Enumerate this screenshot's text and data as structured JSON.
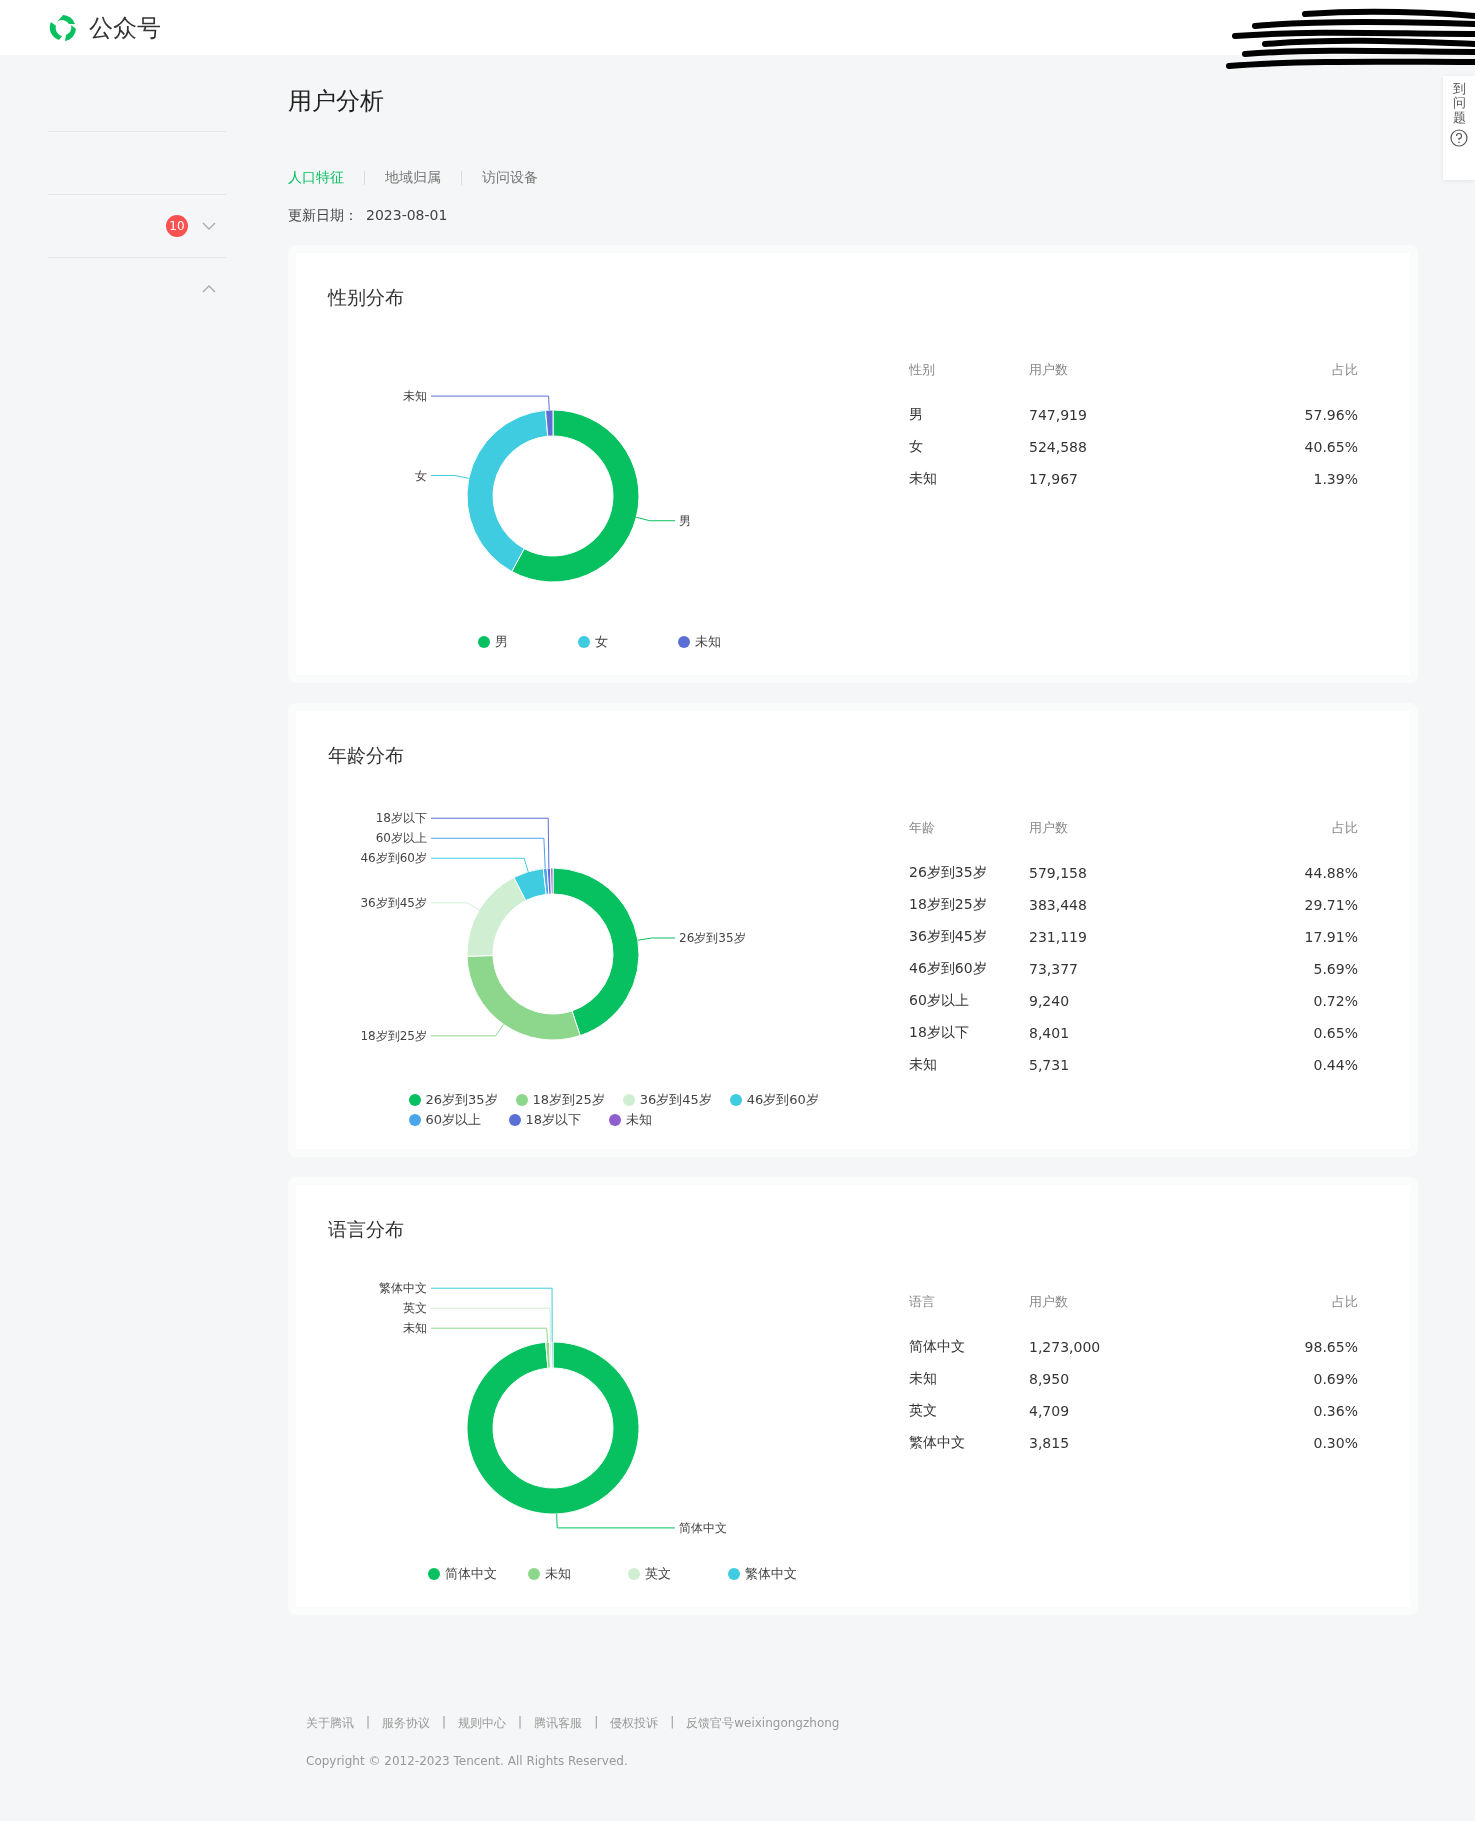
{
  "header": {
    "logo_text": "公众号"
  },
  "sidebar": {
    "badge": "10"
  },
  "help_tab": {
    "label": "到问题"
  },
  "page_title": "用户分析",
  "tabs": [
    {
      "label": "人口特征",
      "selected": true
    },
    {
      "label": "地域归属",
      "selected": false
    },
    {
      "label": "访问设备",
      "selected": false
    }
  ],
  "update_date": {
    "label": "更新日期：",
    "value": "2023-08-01"
  },
  "sections": [
    {
      "title": "性别分布",
      "columns": [
        "性别",
        "用户数",
        "占比"
      ],
      "rows": [
        [
          "男",
          "747,919",
          "57.96%"
        ],
        [
          "女",
          "524,588",
          "40.65%"
        ],
        [
          "未知",
          "17,967",
          "1.39%"
        ]
      ],
      "slice_labels": [
        "未知",
        "女",
        "男"
      ],
      "legend": [
        {
          "color": "#07c160"
        },
        {
          "color": "#40cce0"
        },
        {
          "color": "#5c6fd4"
        }
      ],
      "chart_data": {
        "type": "donut",
        "categories": [
          "男",
          "女",
          "未知"
        ],
        "values": [
          57.96,
          40.65,
          1.39
        ]
      }
    },
    {
      "title": "年龄分布",
      "columns": [
        "年龄",
        "用户数",
        "占比"
      ],
      "rows": [
        [
          "26岁到35岁",
          "579,158",
          "44.88%"
        ],
        [
          "18岁到25岁",
          "383,448",
          "29.71%"
        ],
        [
          "36岁到45岁",
          "231,119",
          "17.91%"
        ],
        [
          "46岁到60岁",
          "73,377",
          "5.69%"
        ],
        [
          "60岁以上",
          "9,240",
          "0.72%"
        ],
        [
          "18岁以下",
          "8,401",
          "0.65%"
        ],
        [
          "未知",
          "5,731",
          "0.44%"
        ]
      ],
      "slice_labels": [
        "18岁以下",
        "60岁以上",
        "46岁到60岁",
        "36岁到45岁",
        "26岁到35岁",
        "18岁到25岁"
      ],
      "legend": [
        {
          "color": "#07c160"
        },
        {
          "color": "#8dd78c"
        },
        {
          "color": "#d0efd2"
        },
        {
          "color": "#40cce0"
        },
        {
          "color": "#4aa5ec"
        },
        {
          "color": "#5c6fd4"
        },
        {
          "color": "#8f5fd0"
        }
      ],
      "chart_data": {
        "type": "donut",
        "categories": [
          "26岁到35岁",
          "18岁到25岁",
          "36岁到45岁",
          "46岁到60岁",
          "60岁以上",
          "18岁以下",
          "未知"
        ],
        "values": [
          44.88,
          29.71,
          17.91,
          5.69,
          0.72,
          0.65,
          0.44
        ]
      }
    },
    {
      "title": "语言分布",
      "columns": [
        "语言",
        "用户数",
        "占比"
      ],
      "rows": [
        [
          "简体中文",
          "1,273,000",
          "98.65%"
        ],
        [
          "未知",
          "8,950",
          "0.69%"
        ],
        [
          "英文",
          "4,709",
          "0.36%"
        ],
        [
          "繁体中文",
          "3,815",
          "0.30%"
        ]
      ],
      "slice_labels": [
        "繁体中文",
        "英文",
        "未知",
        "简体中文"
      ],
      "legend": [
        {
          "color": "#07c160"
        },
        {
          "color": "#8dd78c"
        },
        {
          "color": "#d0efd2"
        },
        {
          "color": "#40cce0"
        }
      ],
      "chart_data": {
        "type": "donut",
        "categories": [
          "简体中文",
          "未知",
          "英文",
          "繁体中文"
        ],
        "values": [
          98.65,
          0.69,
          0.36,
          0.3
        ]
      }
    }
  ],
  "footer": {
    "links": [
      "关于腾讯",
      "服务协议",
      "规则中心",
      "腾讯客服",
      "侵权投诉",
      "反馈官号weixingongzhong"
    ],
    "separator": "|",
    "copyright": "Copyright © 2012-2023 Tencent. All Rights Reserved."
  }
}
